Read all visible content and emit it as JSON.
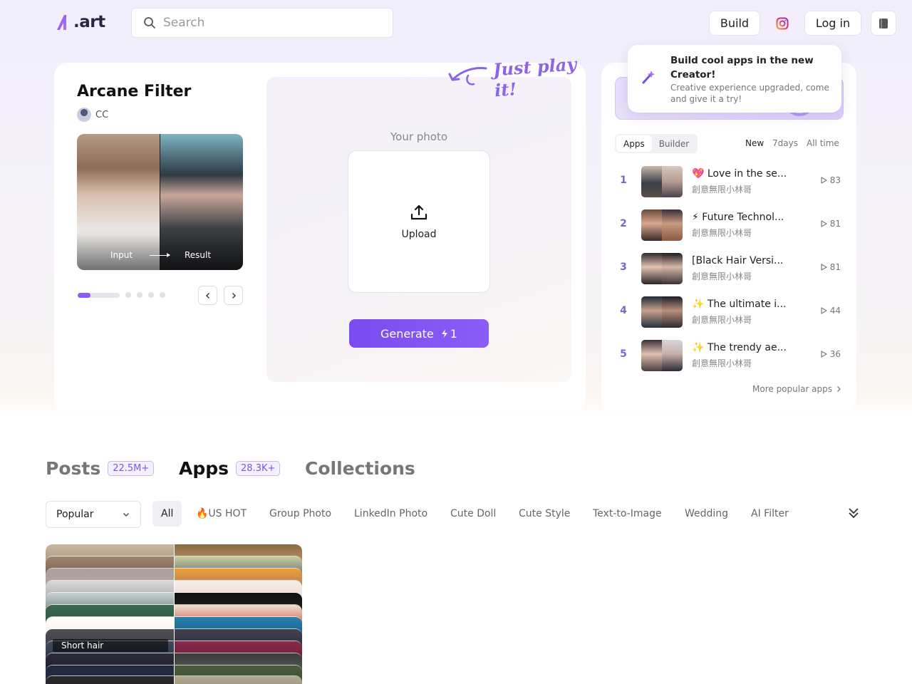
{
  "header": {
    "logo_text": ".art",
    "search_placeholder": "Search",
    "build_label": "Build",
    "login_label": "Log in",
    "instagram_icon": "instagram-icon",
    "book_icon": "book-icon"
  },
  "tooltip": {
    "title": "Build cool apps in the new Creator!",
    "subtitle": "Creative experience upgraded, come and give it a try!"
  },
  "app": {
    "title": "Arcane Filter",
    "author": "CC",
    "input_label": "Input",
    "result_label": "Result",
    "your_photo": "Your photo",
    "upload_label": "Upload",
    "generate_label": "Generate",
    "generate_cost": "1",
    "just_play": "Just play it!",
    "carousel_total": 5,
    "carousel_current": 1
  },
  "ranking": {
    "tabs": [
      "Apps",
      "Builder"
    ],
    "periods": [
      "New",
      "7days",
      "All time"
    ],
    "items": [
      {
        "rank": "1",
        "name": "💖 Love in the se...",
        "author": "創意無限小林哥",
        "plays": "83"
      },
      {
        "rank": "2",
        "name": "⚡ Future Technol...",
        "author": "創意無限小林哥",
        "plays": "81"
      },
      {
        "rank": "3",
        "name": "[Black Hair Versi...",
        "author": "創意無限小林哥",
        "plays": "81"
      },
      {
        "rank": "4",
        "name": "✨ The ultimate i...",
        "author": "創意無限小林哥",
        "plays": "44"
      },
      {
        "rank": "5",
        "name": "✨ The trendy ae...",
        "author": "創意無限小林哥",
        "plays": "36"
      }
    ],
    "more_label": "More popular apps"
  },
  "feed": {
    "tabs": [
      {
        "label": "Posts",
        "count": "22.5M+"
      },
      {
        "label": "Apps",
        "count": "28.3K+"
      },
      {
        "label": "Collections",
        "count": ""
      }
    ],
    "sort_value": "Popular",
    "categories": [
      "All",
      "🔥US HOT",
      "Group Photo",
      "LinkedIn Photo",
      "Cute Doll",
      "Cute Style",
      "Text-to-Image",
      "Wedding",
      "AI Filter"
    ],
    "card_caption": "Short hair"
  },
  "colors": {
    "accent": "#8b5cf6",
    "rank_number": "#7c66c8"
  }
}
